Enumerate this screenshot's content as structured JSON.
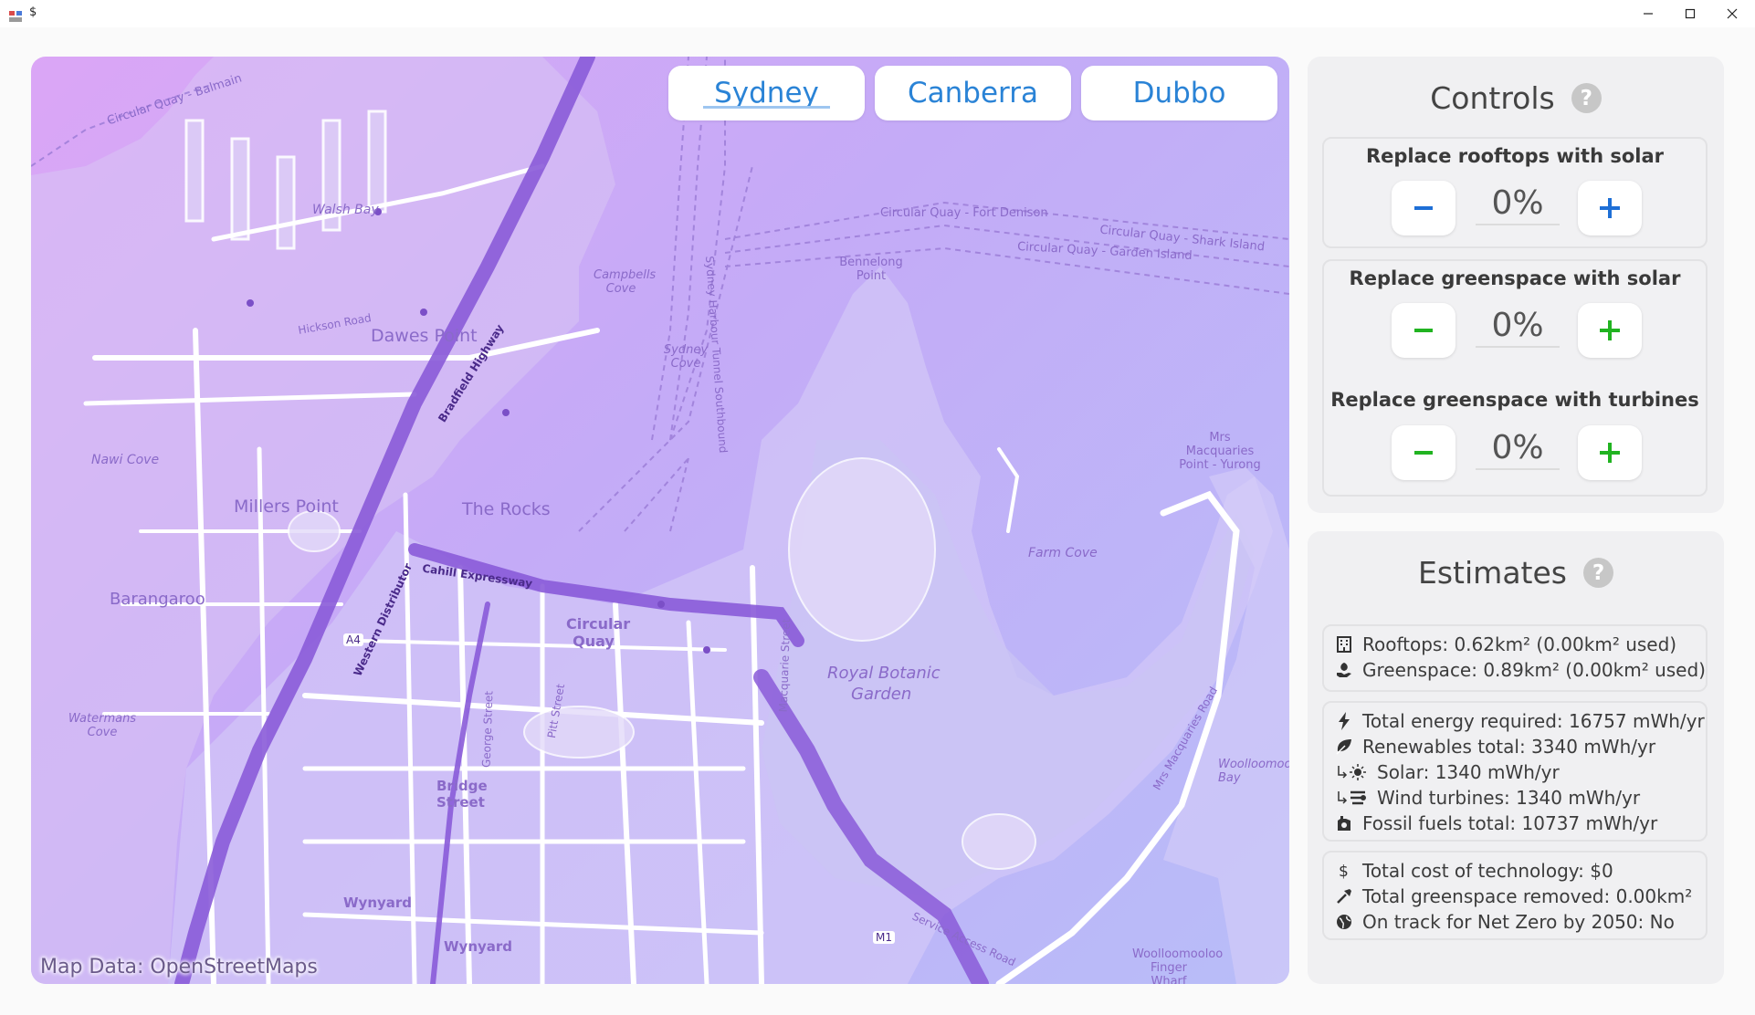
{
  "window": {
    "title": "$"
  },
  "map": {
    "attribution": "Map Data: OpenStreetMaps",
    "city_tabs": [
      {
        "label": "Sydney",
        "active": true
      },
      {
        "label": "Canberra",
        "active": false
      },
      {
        "label": "Dubbo",
        "active": false
      }
    ],
    "labels": {
      "dawes_point": "Dawes Point",
      "millers_point": "Millers Point",
      "the_rocks": "The Rocks",
      "barangaroo": "Barangaroo",
      "circular_quay": "Circular Quay",
      "royal_botanic": "Royal Botanic",
      "garden": "Garden",
      "farm_cove": "Farm Cove",
      "bridge_street_1": "Bridge",
      "bridge_street_2": "Street",
      "wynyard": "Wynyard",
      "wynyard_station": "Wynyard",
      "bennelong_point": "Bennelong Point",
      "mrs_macquaries": "Mrs Macquaries Point - Yurong",
      "walsh_bay": "Walsh Bay",
      "nawi_cove": "Nawi Cove",
      "campbells_cove": "Campbells Cove",
      "sydney_cove": "Sydney Cove",
      "watermans_cove": "Watermans Cove",
      "woolloomooloo_bay": "Woolloomooloo Bay",
      "woolloomooloo_finger": "Woolloomooloo Finger Wharf",
      "cahill_expressway": "Cahill Expressway",
      "western_distributor": "Western Distributor",
      "bradfield_highway": "Bradfield Highway",
      "macquarie_street": "Macquarie Street",
      "george_street": "George Street",
      "pitt_street": "Pitt Street",
      "circular_quay_fort_denison": "Circular Quay - Fort Denison",
      "circular_quay_shark_island": "Circular Quay - Shark Island",
      "circular_quay_garden_island": "Circular Quay - Garden Island",
      "circular_quay_balmain": "Circular Quay - Balmain",
      "sydney_harbour_tunnel": "Sydney Harbour Tunnel Southbound",
      "service_access_road": "Service Access Road",
      "hickson_road": "Hickson Road",
      "mrs_macquaries_road": "Mrs Macquaries Road",
      "m1": "M1",
      "a4": "A4"
    }
  },
  "controls": {
    "title": "Controls",
    "help": "?",
    "rooftops": {
      "label": "Replace rooftops with solar",
      "value": "0%",
      "color": "#1e6fd6"
    },
    "greenspace_solar": {
      "label": "Replace greenspace with solar",
      "value": "0%",
      "color": "#21b321"
    },
    "greenspace_turbines": {
      "label": "Replace greenspace with turbines",
      "value": "0%",
      "color": "#21b321"
    }
  },
  "estimates": {
    "title": "Estimates",
    "help": "?",
    "area": [
      {
        "icon": "building-icon",
        "text": "Rooftops: 0.62km² (0.00km² used)"
      },
      {
        "icon": "leaf-hand-icon",
        "text": "Greenspace: 0.89km² (0.00km² used)"
      }
    ],
    "energy": [
      {
        "icon": "lightning-icon",
        "text": "Total energy required: 16757 mWh/yr"
      },
      {
        "icon": "leaf-icon",
        "text": "Renewables total: 3340 mWh/yr"
      },
      {
        "icon": "sun-icon",
        "text": "Solar: 1340 mWh/yr"
      },
      {
        "icon": "wind-turbine-icon",
        "text": "Wind turbines: 1340 mWh/yr"
      },
      {
        "icon": "factory-icon",
        "text": "Fossil fuels total: 10737 mWh/yr"
      }
    ],
    "summary": [
      {
        "icon": "dollar-icon",
        "text": "Total cost of technology: $0"
      },
      {
        "icon": "shovel-icon",
        "text": "Total greenspace removed: 0.00km²"
      },
      {
        "icon": "globe-icon",
        "text": "On track for Net Zero by 2050: No"
      }
    ]
  }
}
